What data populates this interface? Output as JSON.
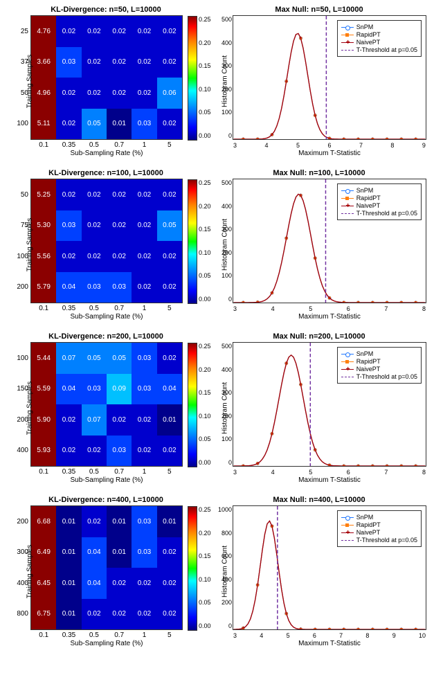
{
  "chart_data": [
    {
      "type": "heatmap",
      "title": "KL-Divergence: n=50, L=10000",
      "xlabel": "Sub-Sampling Rate (%)",
      "ylabel": "Training Samples",
      "x_categories": [
        "0.1",
        "0.35",
        "0.5",
        "0.7",
        "1",
        "5"
      ],
      "y_categories": [
        "25",
        "37",
        "50",
        "100"
      ],
      "values": [
        [
          4.76,
          0.02,
          0.02,
          0.02,
          0.02,
          0.02
        ],
        [
          3.66,
          0.03,
          0.02,
          0.02,
          0.02,
          0.02
        ],
        [
          4.96,
          0.02,
          0.02,
          0.02,
          0.02,
          0.06
        ],
        [
          5.11,
          0.02,
          0.05,
          0.01,
          0.03,
          0.02
        ]
      ],
      "colorbar_range": [
        0.0,
        0.25
      ],
      "colorbar_ticks": [
        "0.00",
        "0.05",
        "0.10",
        "0.15",
        "0.20",
        "0.25"
      ]
    },
    {
      "type": "line",
      "title": "Max Null: n=50, L=10000",
      "xlabel": "Maximum T-Statistic",
      "ylabel": "Histogram Count",
      "xlim": [
        3,
        9
      ],
      "ylim": [
        0,
        500
      ],
      "xticks": [
        "3",
        "4",
        "5",
        "6",
        "7",
        "8",
        "9"
      ],
      "yticks": [
        "0",
        "100",
        "200",
        "300",
        "400",
        "500"
      ],
      "series": [
        {
          "name": "SnPM",
          "color": "#1f77ff",
          "marker": "o",
          "peak_x": 5.0,
          "peak_y": 430
        },
        {
          "name": "RapidPT",
          "color": "#ff7f0e",
          "marker": "sq",
          "peak_x": 5.0,
          "peak_y": 430
        },
        {
          "name": "NaivePT",
          "color": "#a00010",
          "marker": "+",
          "peak_x": 5.0,
          "peak_y": 430
        }
      ],
      "threshold": {
        "label": "T-Threshold at p=0.05",
        "x": 5.9,
        "color": "#7030a0"
      }
    },
    {
      "type": "heatmap",
      "title": "KL-Divergence: n=100, L=10000",
      "xlabel": "Sub-Sampling Rate (%)",
      "ylabel": "Training Samples",
      "x_categories": [
        "0.1",
        "0.35",
        "0.5",
        "0.7",
        "1",
        "5"
      ],
      "y_categories": [
        "50",
        "75",
        "100",
        "200"
      ],
      "values": [
        [
          5.25,
          0.02,
          0.02,
          0.02,
          0.02,
          0.02
        ],
        [
          5.3,
          0.03,
          0.02,
          0.02,
          0.02,
          0.05
        ],
        [
          5.56,
          0.02,
          0.02,
          0.02,
          0.02,
          0.02
        ],
        [
          5.79,
          0.04,
          0.03,
          0.03,
          0.02,
          0.02
        ]
      ],
      "colorbar_range": [
        0.0,
        0.25
      ],
      "colorbar_ticks": [
        "0.00",
        "0.05",
        "0.10",
        "0.15",
        "0.20",
        "0.25"
      ]
    },
    {
      "type": "line",
      "title": "Max Null: n=100, L=10000",
      "xlabel": "Maximum T-Statistic",
      "ylabel": "Histogram Count",
      "xlim": [
        3,
        8
      ],
      "ylim": [
        0,
        500
      ],
      "xticks": [
        "3",
        "4",
        "5",
        "6",
        "7",
        "8"
      ],
      "yticks": [
        "0",
        "100",
        "200",
        "300",
        "400",
        "500"
      ],
      "series": [
        {
          "name": "SnPM",
          "color": "#1f77ff",
          "marker": "o",
          "peak_x": 4.7,
          "peak_y": 440
        },
        {
          "name": "RapidPT",
          "color": "#ff7f0e",
          "marker": "sq",
          "peak_x": 4.7,
          "peak_y": 440
        },
        {
          "name": "NaivePT",
          "color": "#a00010",
          "marker": "+",
          "peak_x": 4.7,
          "peak_y": 440
        }
      ],
      "threshold": {
        "label": "T-Threshold at p=0.05",
        "x": 5.4,
        "color": "#7030a0"
      }
    },
    {
      "type": "heatmap",
      "title": "KL-Divergence: n=200, L=10000",
      "xlabel": "Sub-Sampling Rate (%)",
      "ylabel": "Training Samples",
      "x_categories": [
        "0.1",
        "0.35",
        "0.5",
        "0.7",
        "1",
        "5"
      ],
      "y_categories": [
        "100",
        "150",
        "200",
        "400"
      ],
      "values": [
        [
          5.44,
          0.07,
          0.05,
          0.05,
          0.03,
          0.02
        ],
        [
          5.59,
          0.04,
          0.03,
          0.09,
          0.03,
          0.04
        ],
        [
          5.9,
          0.02,
          0.07,
          0.02,
          0.02,
          0.01
        ],
        [
          5.93,
          0.02,
          0.02,
          0.03,
          0.02,
          0.02
        ]
      ],
      "colorbar_range": [
        0.0,
        0.25
      ],
      "colorbar_ticks": [
        "0.00",
        "0.05",
        "0.10",
        "0.15",
        "0.20",
        "0.25"
      ]
    },
    {
      "type": "line",
      "title": "Max Null: n=200, L=10000",
      "xlabel": "Maximum T-Statistic",
      "ylabel": "Histogram Count",
      "xlim": [
        3,
        8
      ],
      "ylim": [
        0,
        500
      ],
      "xticks": [
        "3",
        "4",
        "5",
        "6",
        "7",
        "8"
      ],
      "yticks": [
        "0",
        "100",
        "200",
        "300",
        "400",
        "500"
      ],
      "series": [
        {
          "name": "SnPM",
          "color": "#1f77ff",
          "marker": "o",
          "peak_x": 4.5,
          "peak_y": 450
        },
        {
          "name": "RapidPT",
          "color": "#ff7f0e",
          "marker": "sq",
          "peak_x": 4.5,
          "peak_y": 450
        },
        {
          "name": "NaivePT",
          "color": "#a00010",
          "marker": "+",
          "peak_x": 4.5,
          "peak_y": 450
        }
      ],
      "threshold": {
        "label": "T-Threshold at p=0.05",
        "x": 5.0,
        "color": "#7030a0"
      }
    },
    {
      "type": "heatmap",
      "title": "KL-Divergence: n=400, L=10000",
      "xlabel": "Sub-Sampling Rate (%)",
      "ylabel": "Training Samples",
      "x_categories": [
        "0.1",
        "0.35",
        "0.5",
        "0.7",
        "1",
        "5"
      ],
      "y_categories": [
        "200",
        "300",
        "400",
        "800"
      ],
      "values": [
        [
          6.68,
          0.01,
          0.02,
          0.01,
          0.03,
          0.01
        ],
        [
          6.49,
          0.01,
          0.04,
          0.01,
          0.03,
          0.02
        ],
        [
          6.45,
          0.01,
          0.04,
          0.02,
          0.02,
          0.02
        ],
        [
          6.75,
          0.01,
          0.02,
          0.02,
          0.02,
          0.02
        ]
      ],
      "colorbar_range": [
        0.0,
        0.25
      ],
      "colorbar_ticks": [
        "0.00",
        "0.05",
        "0.10",
        "0.15",
        "0.20",
        "0.25"
      ]
    },
    {
      "type": "line",
      "title": "Max Null: n=400, L=10000",
      "xlabel": "Maximum T-Statistic",
      "ylabel": "Histogram Count",
      "xlim": [
        3,
        10
      ],
      "ylim": [
        0,
        1000
      ],
      "xticks": [
        "3",
        "4",
        "5",
        "6",
        "7",
        "8",
        "9",
        "10"
      ],
      "yticks": [
        "0",
        "200",
        "400",
        "600",
        "800",
        "1000"
      ],
      "series": [
        {
          "name": "SnPM",
          "color": "#1f77ff",
          "marker": "o",
          "peak_x": 4.3,
          "peak_y": 880
        },
        {
          "name": "RapidPT",
          "color": "#ff7f0e",
          "marker": "sq",
          "peak_x": 4.3,
          "peak_y": 880
        },
        {
          "name": "NaivePT",
          "color": "#a00010",
          "marker": "+",
          "peak_x": 4.3,
          "peak_y": 880
        }
      ],
      "threshold": {
        "label": "T-Threshold at p=0.05",
        "x": 4.6,
        "color": "#7030a0"
      }
    }
  ]
}
